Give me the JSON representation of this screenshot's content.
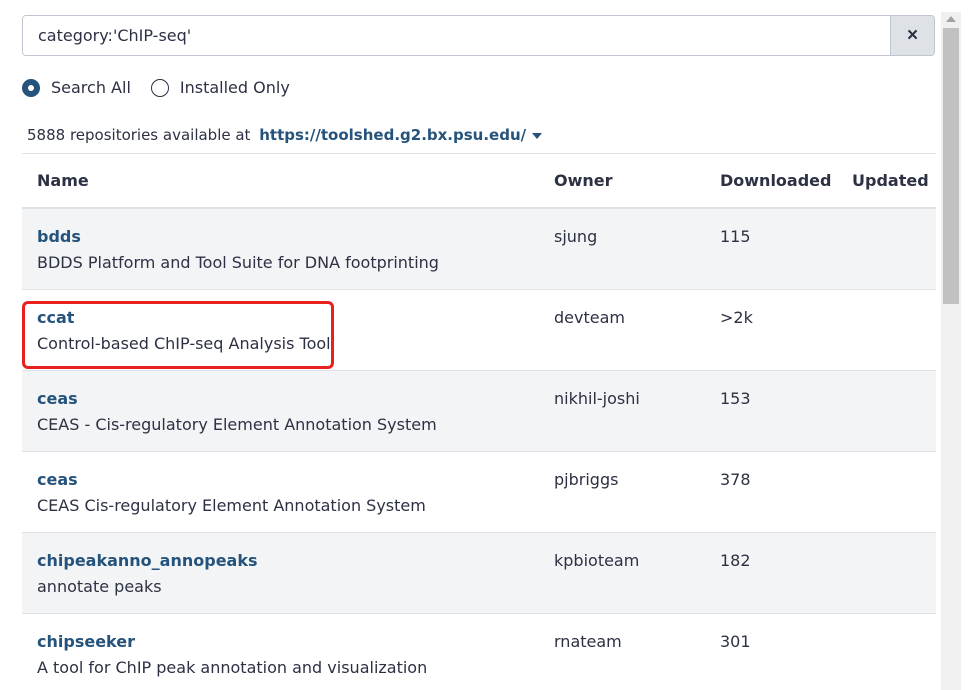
{
  "search": {
    "value": "category:'ChIP-seq'",
    "clear_icon": "×"
  },
  "filters": {
    "search_all_label": "Search All",
    "installed_only_label": "Installed Only",
    "selected": "search_all"
  },
  "repo_count": {
    "text": "5888 repositories available at",
    "url": "https://toolshed.g2.bx.psu.edu/"
  },
  "table": {
    "headers": {
      "name": "Name",
      "owner": "Owner",
      "downloaded": "Downloaded",
      "updated": "Updated"
    },
    "rows": [
      {
        "name": "bdds",
        "description": "BDDS Platform and Tool Suite for DNA footprinting",
        "owner": "sjung",
        "downloaded": "115",
        "updated": ""
      },
      {
        "name": "ccat",
        "description": "Control-based ChIP-seq Analysis Tool",
        "owner": "devteam",
        "downloaded": ">2k",
        "updated": ""
      },
      {
        "name": "ceas",
        "description": "CEAS - Cis-regulatory Element Annotation System",
        "owner": "nikhil-joshi",
        "downloaded": "153",
        "updated": ""
      },
      {
        "name": "ceas",
        "description": "CEAS Cis-regulatory Element Annotation System",
        "owner": "pjbriggs",
        "downloaded": "378",
        "updated": ""
      },
      {
        "name": "chipeakanno_annopeaks",
        "description": "annotate peaks",
        "owner": "kpbioteam",
        "downloaded": "182",
        "updated": ""
      },
      {
        "name": "chipseeker",
        "description": "A tool for ChIP peak annotation and visualization",
        "owner": "rnateam",
        "downloaded": "301",
        "updated": ""
      }
    ]
  },
  "colors": {
    "link": "#25537b",
    "highlight": "#e8201e",
    "stripe": "#f3f4f6"
  }
}
